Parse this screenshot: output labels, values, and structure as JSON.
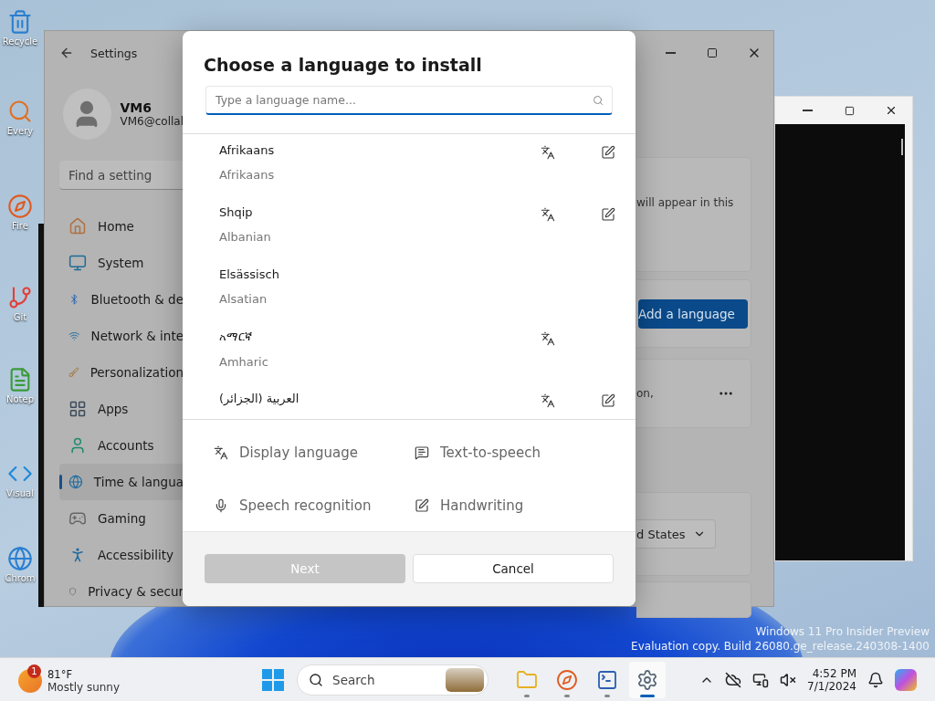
{
  "desktop_icons": [
    {
      "label": "Recycle",
      "kind": "bin"
    },
    {
      "label": "Every",
      "kind": "search"
    },
    {
      "label": "Fire",
      "kind": "browser"
    },
    {
      "label": "Git",
      "kind": "git"
    },
    {
      "label": "Notep",
      "kind": "notepad"
    },
    {
      "label": "Visual",
      "kind": "code"
    },
    {
      "label": "Chrom",
      "kind": "globe"
    }
  ],
  "settings": {
    "title": "Settings",
    "user": {
      "name": "VM6",
      "email": "VM6@collal"
    },
    "search": {
      "placeholder": "Find a setting"
    },
    "nav": [
      {
        "label": "Home",
        "kind": "home",
        "selected": false
      },
      {
        "label": "System",
        "kind": "system",
        "selected": false
      },
      {
        "label": "Bluetooth & de",
        "kind": "bluetooth",
        "selected": false
      },
      {
        "label": "Network & inte",
        "kind": "network",
        "selected": false
      },
      {
        "label": "Personalization",
        "kind": "brush",
        "selected": false
      },
      {
        "label": "Apps",
        "kind": "apps",
        "selected": false
      },
      {
        "label": "Accounts",
        "kind": "accounts",
        "selected": false
      },
      {
        "label": "Time & langua",
        "kind": "time",
        "selected": true
      },
      {
        "label": "Gaming",
        "kind": "gaming",
        "selected": false
      },
      {
        "label": "Accessibility",
        "kind": "accessibility",
        "selected": false
      },
      {
        "label": "Privacy & secur",
        "kind": "privacy",
        "selected": false
      }
    ],
    "content": {
      "info_text": "will appear in this",
      "add_button": "Add a language",
      "language_text": "on,",
      "region_value": "d States"
    }
  },
  "dialog": {
    "title": "Choose a language to install",
    "search": {
      "placeholder": "Type a language name..."
    },
    "languages": [
      {
        "name": "Afrikaans",
        "english": "Afrikaans",
        "display_language": true,
        "handwriting": true
      },
      {
        "name": "Shqip",
        "english": "Albanian",
        "display_language": true,
        "handwriting": true
      },
      {
        "name": "Elsässisch",
        "english": "Alsatian",
        "display_language": false,
        "handwriting": false
      },
      {
        "name": "አማርኛ",
        "english": "Amharic",
        "display_language": true,
        "handwriting": false
      },
      {
        "name": "العربية (الجزائر)",
        "display_language": true,
        "handwriting": true
      }
    ],
    "legend": [
      {
        "kind": "display",
        "label": "Display language"
      },
      {
        "kind": "tts",
        "label": "Text-to-speech"
      },
      {
        "kind": "speech",
        "label": "Speech recognition"
      },
      {
        "kind": "handwriting",
        "label": "Handwriting"
      }
    ],
    "buttons": [
      {
        "label": "Next",
        "kind": "primary",
        "disabled": true
      },
      {
        "label": "Cancel",
        "kind": "secondary",
        "disabled": false
      }
    ]
  },
  "watermark": {
    "line_1": "Windows 11 Pro Insider Preview",
    "line_2": "Evaluation copy. Build 26080.ge_release.240308-1400"
  },
  "taskbar": {
    "weather": {
      "badge": "1",
      "temperature": "81°F",
      "condition": "Mostly sunny"
    },
    "search": {
      "label": "Search"
    },
    "apps": [
      {
        "kind": "folder",
        "selected": false
      },
      {
        "kind": "browser",
        "selected": false
      },
      {
        "kind": "terminal",
        "selected": false
      },
      {
        "kind": "settings",
        "selected": true
      }
    ],
    "clock": {
      "time": "4:52 PM",
      "date": "7/1/2024"
    }
  }
}
